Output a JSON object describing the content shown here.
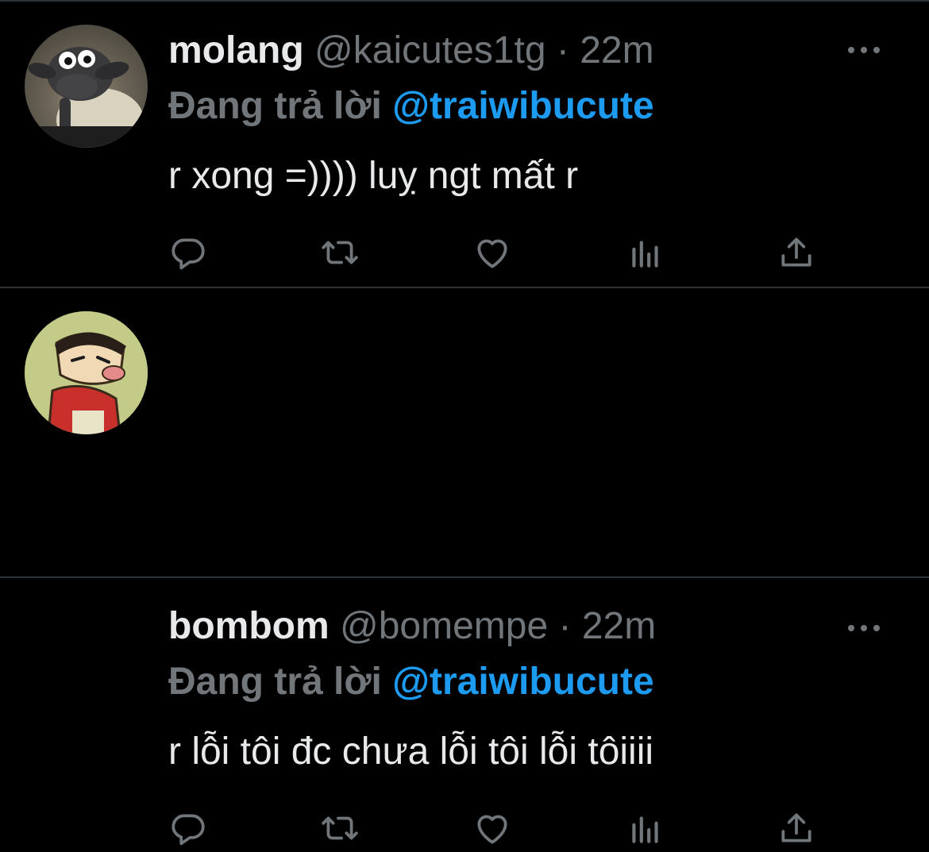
{
  "tweets": [
    {
      "display_name": "molang",
      "handle": "@kaicutes1tg",
      "separator": "·",
      "time": "22m",
      "reply_prefix": "Đang trả lời",
      "reply_to": "@traiwibucute",
      "text": "r xong =)))) luỵ ngt mất r"
    },
    {
      "display_name": "bombom",
      "handle": "@bomempe",
      "separator": "·",
      "time": "22m",
      "reply_prefix": "Đang trả lời",
      "reply_to": "@traiwibucute",
      "text": "r lỗi tôi đc chưa lỗi tôi lỗi tôiiii"
    }
  ],
  "icons": {
    "reply": "reply-icon",
    "retweet": "retweet-icon",
    "like": "heart-icon",
    "views": "views-icon",
    "share": "share-icon",
    "more": "more-icon"
  },
  "colors": {
    "background": "#000000",
    "text": "#e7e9ea",
    "muted": "#71767b",
    "accent": "#1d9bf0",
    "divider": "#2f3336"
  }
}
